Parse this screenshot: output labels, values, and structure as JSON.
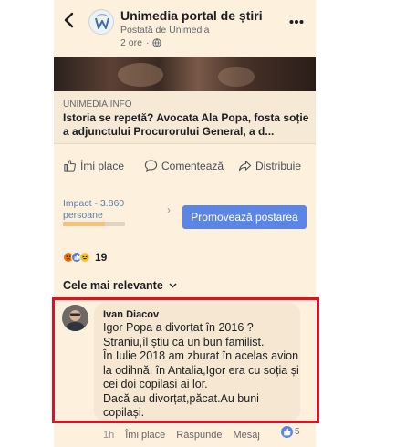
{
  "header": {
    "page_name": "Unimedia portal de știri",
    "posted_by": "Postată de Unimedia",
    "time": "2 ore",
    "back_icon": "arrow-left-icon",
    "more_icon": "more-horizontal-icon"
  },
  "link_preview": {
    "domain": "UNIMEDIA.INFO",
    "title": "Istoria se repetă? Avocata Ala Popa, fosta soție a adjunctului Procurorului General, a d..."
  },
  "actions": {
    "like": "Îmi place",
    "comment": "Comentează",
    "share": "Distribuie"
  },
  "boost": {
    "impact_label": "Impact - 3.860 persoane",
    "impact_progress": 0.68,
    "promote_label": "Promovează postarea"
  },
  "reactions": {
    "icons": [
      "angry-reaction-icon",
      "like-reaction-icon",
      "haha-reaction-icon"
    ],
    "count": "19"
  },
  "sort": {
    "label": "Cele mai relevante"
  },
  "comment": {
    "author": "Ivan Diacov",
    "text": "Igor Popa a divorțat în 2016 ?\nStraniu,îl știu ca un bun familist.\nÎn Iulie 2018 am zburat în acelaș avion la odihnă, în Antalia,Igor era cu soția și cei doi copilași ai lor.\nDacă au divorțat,păcat.Au buni copilași.",
    "time": "1h",
    "like": "Îmi place",
    "reply": "Răspunde",
    "message": "Mesaj",
    "reaction_count": "5"
  },
  "colors": {
    "panel_bg": "#fdf0dc",
    "accent": "#5b86e5",
    "highlight": "#e01020"
  }
}
